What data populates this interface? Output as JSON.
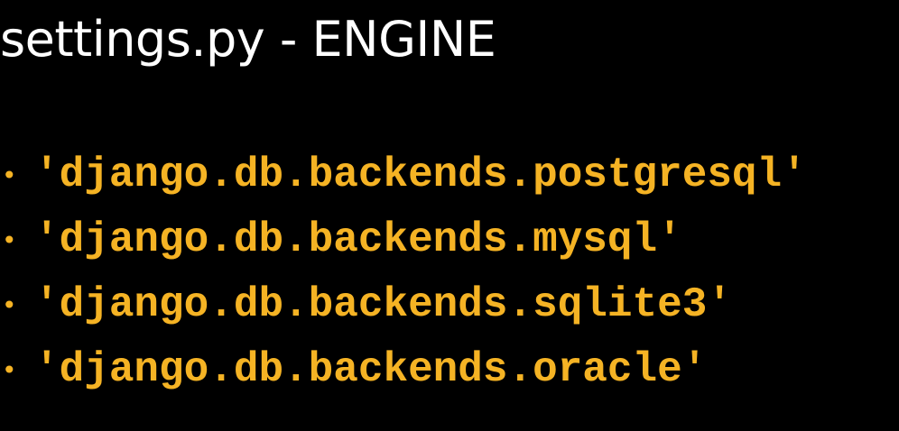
{
  "slide": {
    "title": "settings.py - ENGINE",
    "bullet_symbol": "•",
    "items": [
      {
        "text": "'django.db.backends.postgresql'"
      },
      {
        "text": "'django.db.backends.mysql'"
      },
      {
        "text": "'django.db.backends.sqlite3'"
      },
      {
        "text": "'django.db.backends.oracle'"
      }
    ]
  },
  "colors": {
    "background": "#000000",
    "title": "#ffffff",
    "accent": "#f5b324"
  }
}
